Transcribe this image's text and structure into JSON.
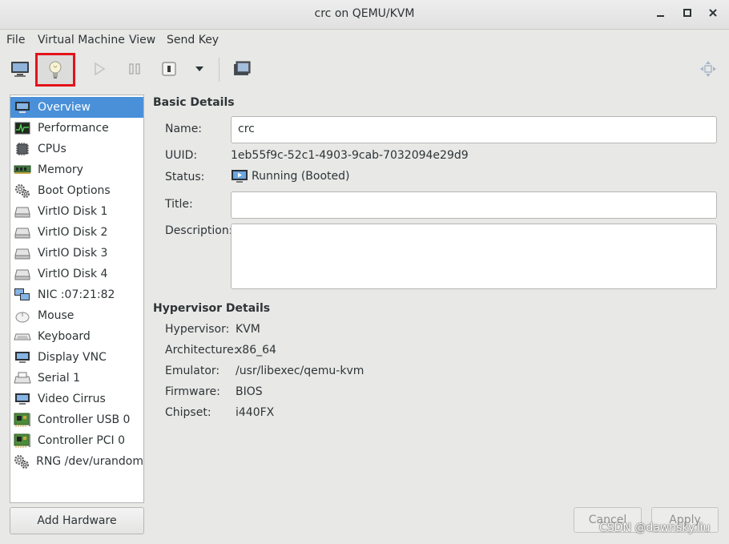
{
  "window": {
    "title": "crc on QEMU/KVM"
  },
  "menubar": {
    "items": [
      "File",
      "Virtual Machine",
      "View",
      "Send Key"
    ]
  },
  "sidebar": {
    "items": [
      {
        "label": "Overview",
        "icon": "monitor-icon"
      },
      {
        "label": "Performance",
        "icon": "performance-graph-icon"
      },
      {
        "label": "CPUs",
        "icon": "cpu-chip-icon"
      },
      {
        "label": "Memory",
        "icon": "memory-module-icon"
      },
      {
        "label": "Boot Options",
        "icon": "gears-icon"
      },
      {
        "label": "VirtIO Disk 1",
        "icon": "hard-disk-icon"
      },
      {
        "label": "VirtIO Disk 2",
        "icon": "hard-disk-icon"
      },
      {
        "label": "VirtIO Disk 3",
        "icon": "hard-disk-icon"
      },
      {
        "label": "VirtIO Disk 4",
        "icon": "hard-disk-icon"
      },
      {
        "label": "NIC :07:21:82",
        "icon": "network-icon"
      },
      {
        "label": "Mouse",
        "icon": "mouse-icon"
      },
      {
        "label": "Keyboard",
        "icon": "keyboard-icon"
      },
      {
        "label": "Display VNC",
        "icon": "display-icon"
      },
      {
        "label": "Serial 1",
        "icon": "serial-port-icon"
      },
      {
        "label": "Video Cirrus",
        "icon": "display-icon"
      },
      {
        "label": "Controller USB 0",
        "icon": "controller-card-icon"
      },
      {
        "label": "Controller PCI 0",
        "icon": "controller-card-icon"
      },
      {
        "label": "RNG /dev/urandom",
        "icon": "gears-icon"
      }
    ],
    "selected": "Overview",
    "add_hardware_label": "Add Hardware"
  },
  "basic": {
    "heading": "Basic Details",
    "name_label": "Name:",
    "name_value": "crc",
    "uuid_label": "UUID:",
    "uuid_value": "1eb55f9c-52c1-4903-9cab-7032094e29d9",
    "status_label": "Status:",
    "status_value": "Running (Booted)",
    "title_label": "Title:",
    "title_value": "",
    "description_label": "Description:",
    "description_value": ""
  },
  "hypervisor": {
    "heading": "Hypervisor Details",
    "rows": [
      {
        "label": "Hypervisor:",
        "value": "KVM"
      },
      {
        "label": "Architecture:",
        "value": "x86_64"
      },
      {
        "label": "Emulator:",
        "value": "/usr/libexec/qemu-kvm"
      },
      {
        "label": "Firmware:",
        "value": "BIOS"
      },
      {
        "label": "Chipset:",
        "value": "i440FX"
      }
    ]
  },
  "buttons": {
    "cancel": "Cancel",
    "apply": "Apply"
  },
  "watermark": "CSDN @dawnsky.liu",
  "colors": {
    "selection": "#4a90d9",
    "highlight_border": "#e3131b"
  }
}
